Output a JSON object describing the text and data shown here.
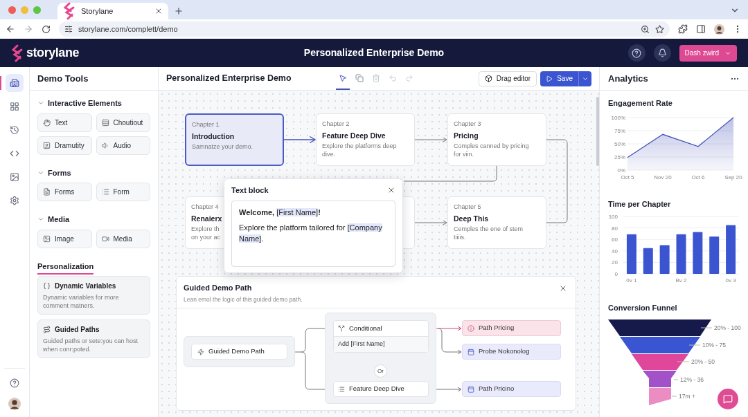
{
  "browser": {
    "tab_title": "Storylane",
    "url": "storylane.com/complett/demo"
  },
  "header": {
    "logo": "storylane",
    "title": "Personalized Enterprise Demo",
    "account_button": "Dash zwird"
  },
  "rail_items": [
    {
      "selected": true
    },
    {
      "selected": false
    },
    {
      "selected": false
    },
    {
      "selected": false
    },
    {
      "selected": false
    },
    {
      "selected": false
    }
  ],
  "tools_panel": {
    "title": "Demo Tools",
    "sections": [
      {
        "title": "Interactive Elements",
        "expanded": true,
        "items": [
          "Text",
          "Choutiout",
          "Dramutity",
          "Audio"
        ]
      },
      {
        "title": "Forms",
        "expanded": true,
        "items": [
          "Forms",
          "Form"
        ]
      },
      {
        "title": "Media",
        "expanded": true,
        "items": [
          "Image",
          "Media"
        ]
      }
    ],
    "personalization": {
      "title": "Personalization",
      "cards": [
        {
          "title": "Dynamic Variables",
          "description": "Dynamic variables for more comment matners."
        },
        {
          "title": "Guided Paths",
          "description": "Guided paths or sete:you can host when conr:poted."
        }
      ]
    }
  },
  "editor": {
    "title": "Personalized Enterprise Demo",
    "tools": [
      {
        "selected": true,
        "disabled": false
      },
      {
        "selected": false,
        "disabled": false
      },
      {
        "selected": false,
        "disabled": true
      },
      {
        "selected": false,
        "disabled": true
      },
      {
        "selected": false,
        "disabled": true
      }
    ],
    "drag_editor": "Drag editor",
    "save": "Save"
  },
  "chapters": [
    {
      "label": "Chapter 1",
      "title": "Introduction",
      "description": [
        "Samnatze your demo."
      ],
      "selected": true
    },
    {
      "label": "Chapter 2",
      "title": "Feature Deep Dive",
      "description": [
        "Explore the platforms deep",
        "dive."
      ],
      "selected": false
    },
    {
      "label": "Chapter 3",
      "title": "Pricing",
      "description": [
        "Comples canned by pricing",
        "for viin."
      ],
      "selected": false
    },
    {
      "label": "Chapter 4",
      "title": "Renaierx",
      "description": [
        "Explore th",
        "on your ac"
      ],
      "selected": false
    },
    {
      "label": "Chapter 5",
      "title": "Deep This",
      "description": [
        "Cemples the ene of stem",
        "tiiiis."
      ],
      "selected": false
    }
  ],
  "text_block": {
    "title": "Text block",
    "paragraphs": [
      [
        {
          "text": "Welcome, ",
          "kind": "bold"
        },
        {
          "text": "[First Name]",
          "kind": "variable"
        },
        {
          "text": "!",
          "kind": "bold"
        }
      ],
      [
        {
          "text": "Explore the platform tailored for ",
          "kind": "plain"
        },
        {
          "text": "[Company Name]",
          "kind": "variable"
        },
        {
          "text": ".",
          "kind": "plain"
        }
      ]
    ]
  },
  "guided_path": {
    "title": "Guided Demo Path",
    "subtitle": "Lean emol the logic of this guided demo path.",
    "start": "Guided Demo Path",
    "condition": {
      "title": "Conditional",
      "detail": "Add [First Name]"
    },
    "or": "Or",
    "fallback": "Feature Deep Dive",
    "targets": [
      {
        "label": "Path Pricing",
        "kind": "alert",
        "color": "#fbe3ea"
      },
      {
        "label": "Probe Nokonolog",
        "kind": "page",
        "color": "#e9eafb"
      },
      {
        "label": "Path Pricino",
        "kind": "page",
        "color": "#e9eafb"
      }
    ]
  },
  "analytics": {
    "title": "Analytics",
    "engagement": {
      "title": "Engagement Rate",
      "chart_data": {
        "type": "area",
        "categories": [
          "Oct 5",
          "Nov 20",
          "Oct 6",
          "Sep 20"
        ],
        "series": [
          {
            "color": "#4352b8",
            "values": [
              24,
              68,
              45,
              100
            ]
          }
        ],
        "ylim": [
          0,
          100
        ],
        "grid": true,
        "yticks": [
          {
            "value": 0,
            "label": "0%"
          },
          {
            "value": 25,
            "label": "25%"
          },
          {
            "value": 50,
            "label": "50%"
          },
          {
            "value": 75,
            "label": "75%"
          },
          {
            "value": 100,
            "label": "100%"
          }
        ]
      }
    },
    "time": {
      "title": "Time per Chapter",
      "chart_data": {
        "type": "bar",
        "categories": [
          "0v 1",
          null,
          null,
          "Bv 2",
          null,
          null,
          "0v 3"
        ],
        "series": [
          {
            "color": "#3b55d0",
            "values": [
              69,
              45,
              50,
              69,
              73,
              65,
              85
            ]
          }
        ],
        "ylim": [
          0,
          100
        ],
        "grid": true,
        "yticks": [
          0,
          20,
          40,
          60,
          80,
          100
        ]
      }
    },
    "funnel": {
      "title": "Conversion Funnel",
      "stages": [
        {
          "label": "20% - 100",
          "color": "#151a4a"
        },
        {
          "label": "10% - 75",
          "color": "#3a55d2"
        },
        {
          "label": "20% - 50",
          "color": "#e0469a"
        },
        {
          "label": "12% - 36",
          "color": "#a351c8"
        },
        {
          "label": "17m +",
          "color": "#eb8cc2"
        }
      ]
    }
  }
}
